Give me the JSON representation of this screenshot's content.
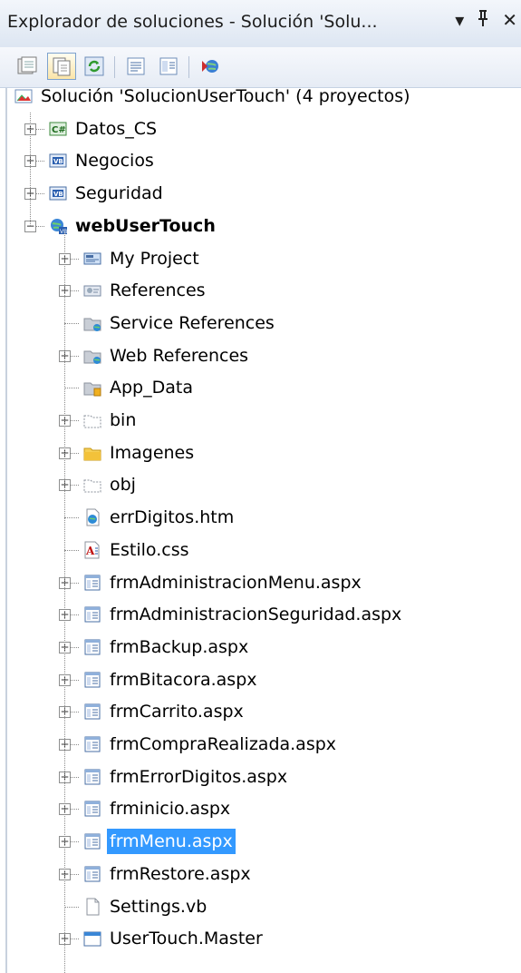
{
  "window": {
    "title": "Explorador de soluciones - Solución 'Solu...",
    "pin_glyph": "¶",
    "close_glyph": "✕",
    "dropdown_glyph": "▾"
  },
  "toolbar": {
    "buttons": [
      "properties",
      "show-all-files",
      "refresh",
      "view-code",
      "view-designer",
      "copy-website"
    ]
  },
  "tree": {
    "solution": "Solución 'SolucionUserTouch'  (4 proyectos)",
    "projects": [
      {
        "name": "Datos_CS",
        "icon": "csharp-project-icon"
      },
      {
        "name": "Negocios",
        "icon": "vb-project-icon"
      },
      {
        "name": "Seguridad",
        "icon": "vb-project-icon"
      },
      {
        "name": "webUserTouch",
        "icon": "web-project-icon"
      }
    ],
    "children": [
      {
        "label": "My Project",
        "icon": "my-project-icon",
        "expandable": true
      },
      {
        "label": "References",
        "icon": "references-icon",
        "expandable": true
      },
      {
        "label": "Service References",
        "icon": "service-ref-folder-icon",
        "expandable": false
      },
      {
        "label": "Web References",
        "icon": "web-ref-folder-icon",
        "expandable": true
      },
      {
        "label": "App_Data",
        "icon": "app-data-folder-icon",
        "expandable": false
      },
      {
        "label": "bin",
        "icon": "dashed-folder-icon",
        "expandable": true
      },
      {
        "label": "Imagenes",
        "icon": "folder-icon",
        "expandable": true
      },
      {
        "label": "obj",
        "icon": "dashed-folder-icon",
        "expandable": true
      },
      {
        "label": "errDigitos.htm",
        "icon": "html-file-icon",
        "expandable": false
      },
      {
        "label": "Estilo.css",
        "icon": "css-file-icon",
        "expandable": false
      },
      {
        "label": "frmAdministracionMenu.aspx",
        "icon": "aspx-file-icon",
        "expandable": true
      },
      {
        "label": "frmAdministracionSeguridad.aspx",
        "icon": "aspx-file-icon",
        "expandable": true
      },
      {
        "label": "frmBackup.aspx",
        "icon": "aspx-file-icon",
        "expandable": true
      },
      {
        "label": "frmBitacora.aspx",
        "icon": "aspx-file-icon",
        "expandable": true
      },
      {
        "label": "frmCarrito.aspx",
        "icon": "aspx-file-icon",
        "expandable": true
      },
      {
        "label": "frmCompraRealizada.aspx",
        "icon": "aspx-file-icon",
        "expandable": true
      },
      {
        "label": "frmErrorDigitos.aspx",
        "icon": "aspx-file-icon",
        "expandable": true
      },
      {
        "label": "frminicio.aspx",
        "icon": "aspx-file-icon",
        "expandable": true
      },
      {
        "label": "frmMenu.aspx",
        "icon": "aspx-file-icon",
        "expandable": true,
        "selected": true
      },
      {
        "label": "frmRestore.aspx",
        "icon": "aspx-file-icon",
        "expandable": true
      },
      {
        "label": "Settings.vb",
        "icon": "vb-file-icon",
        "expandable": false
      },
      {
        "label": "UserTouch.Master",
        "icon": "master-file-icon",
        "expandable": true
      }
    ]
  },
  "colors": {
    "selection": "#3399ff",
    "titlebar": "#dde6f2"
  }
}
